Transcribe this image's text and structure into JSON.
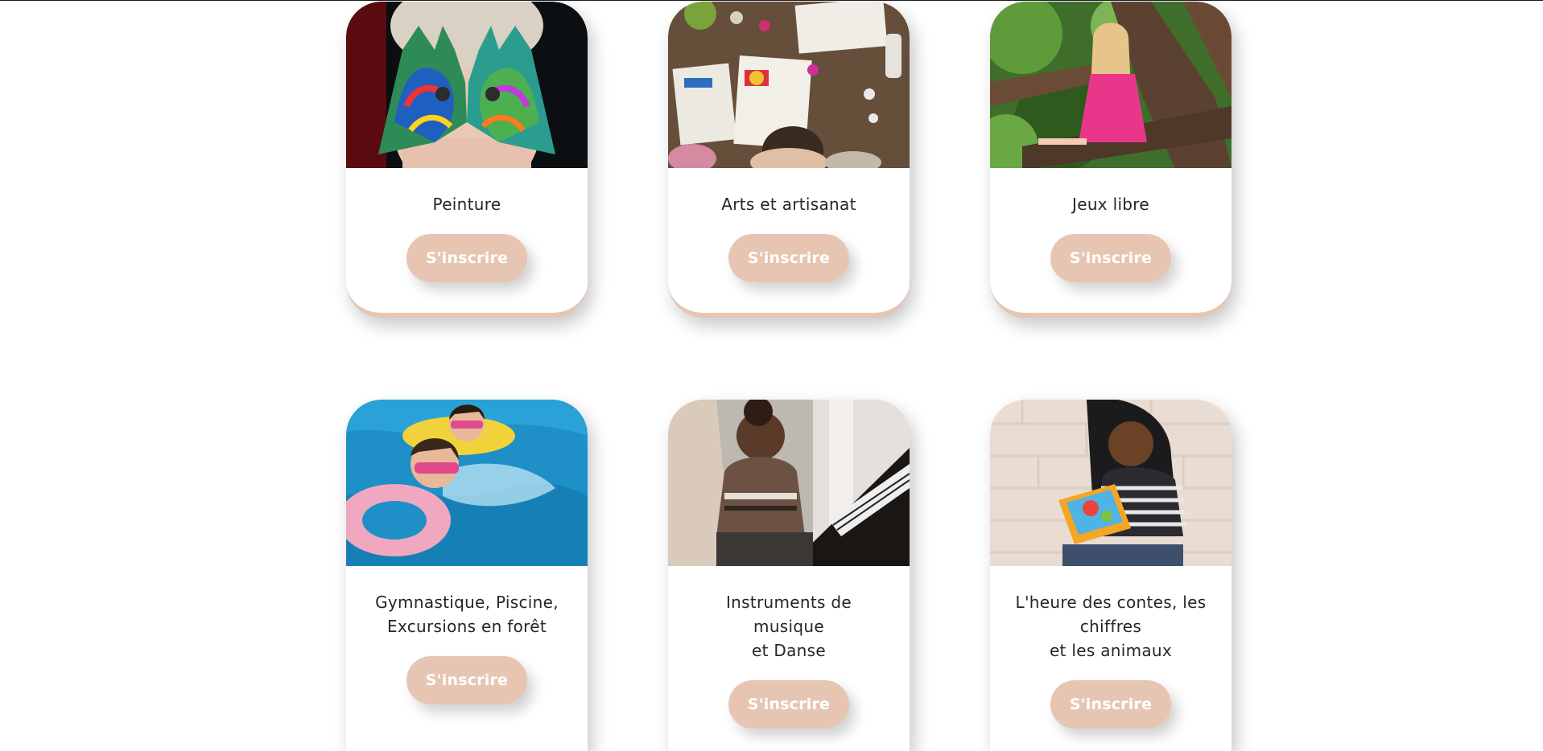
{
  "activities": [
    {
      "title": "Peinture",
      "button_label": "S'inscrire",
      "image": "child-painted-hands-photo"
    },
    {
      "title": "Arts et artisanat",
      "button_label": "S'inscrire",
      "image": "kids-crafts-table-photo"
    },
    {
      "title": "Jeux libre",
      "button_label": "S'inscrire",
      "image": "girl-in-tree-photo"
    },
    {
      "title": "Gymnastique, Piscine,\nExcursions en forêt",
      "button_label": "S'inscrire",
      "image": "kids-swimming-photo"
    },
    {
      "title": "Instruments de musique\net Danse",
      "button_label": "S'inscrire",
      "image": "child-piano-photo"
    },
    {
      "title": "L'heure des contes, les\nchiffres\net les animaux",
      "button_label": "S'inscrire",
      "image": "child-reading-book-photo"
    }
  ],
  "colors": {
    "button_bg": "#e6c6b2",
    "button_text": "#ffffff",
    "card_bg": "#ffffff",
    "page_bg": "#ffffff"
  }
}
